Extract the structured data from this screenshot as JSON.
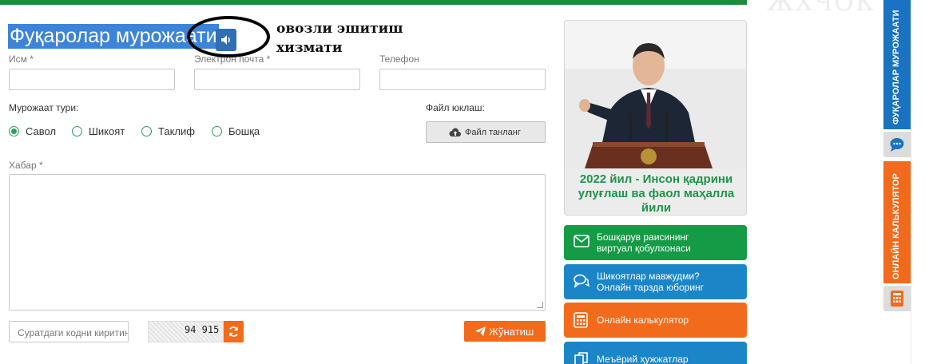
{
  "title": "Фуқаролар мурожаати",
  "tts_note": "овозли эшитиш хизмати",
  "form": {
    "name_label": "Исм *",
    "email_label": "Электрон почта *",
    "phone_label": "Телефон",
    "type_label": "Мурожаат тури:",
    "types": [
      {
        "label": "Савол",
        "selected": true
      },
      {
        "label": "Шикоят",
        "selected": false
      },
      {
        "label": "Таклиф",
        "selected": false
      },
      {
        "label": "Бошқа",
        "selected": false
      }
    ],
    "file_label": "Файл юклаш:",
    "file_button": "Файл танланг",
    "message_label": "Хабар *",
    "captcha_placeholder": "Суратдаги кодни киритинг",
    "captcha_code": "94 915",
    "submit_label": "Жўнатиш"
  },
  "promo": {
    "caption": "2022 йил - Инсон қадрини улуғлаш ва фаол маҳалла йили"
  },
  "services": [
    {
      "label_1": "Бошқарув раисининг",
      "label_2": "виртуал қобулхонаси",
      "color": "#159a45",
      "icon": "envelope-icon"
    },
    {
      "label_1": "Шикоятлар мавжудми?",
      "label_2": "Онлайн тарзда юборинг",
      "color": "#1a86c8",
      "icon": "chat-icon"
    },
    {
      "label_1": "Онлайн калькулятор",
      "label_2": "",
      "color": "#f26a1b",
      "icon": "calculator-icon"
    },
    {
      "label_1": "Меъёрий ҳужжатлар",
      "label_2": "",
      "color": "#1a86c8",
      "icon": "documents-icon"
    }
  ],
  "side_tabs": {
    "appeals": "ФУҚАРОЛАР МУРОЖААТИ",
    "calculator": "ОНЛАЙН КАЛЬКУЛЯТОР"
  },
  "colors": {
    "green": "#1f8a3b",
    "blue": "#1a86c8",
    "orange": "#f26a1b",
    "highlight": "#3c84d8"
  }
}
